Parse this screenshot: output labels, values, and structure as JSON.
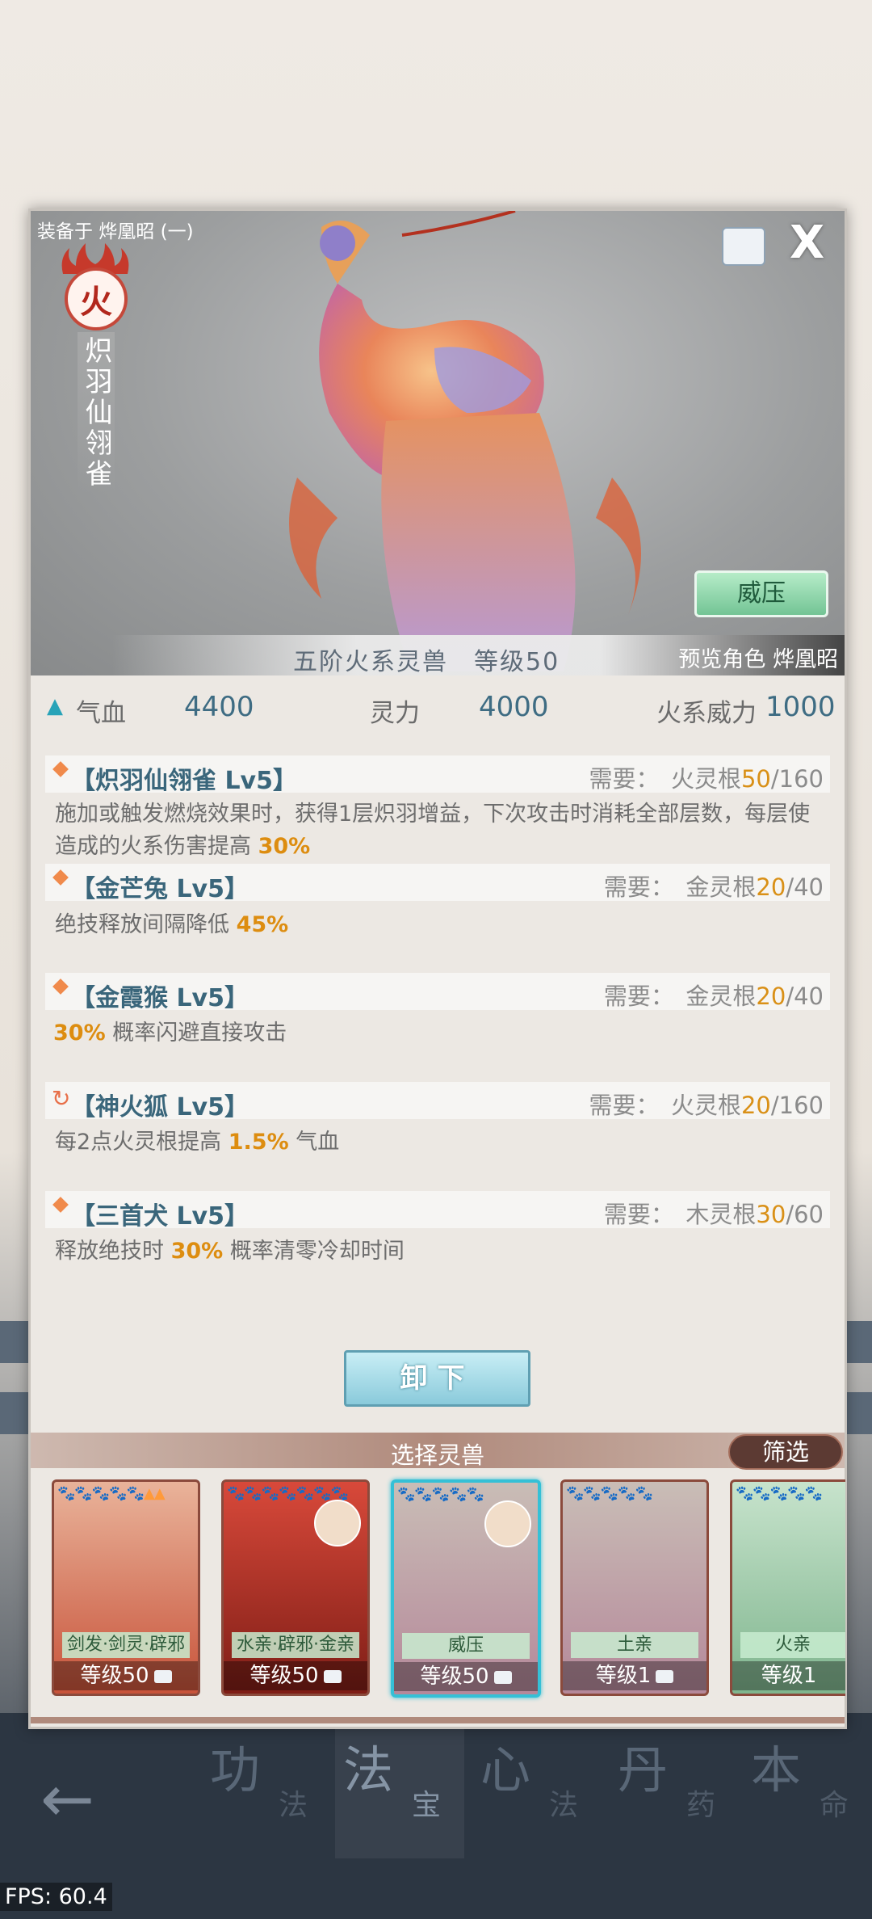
{
  "header": {
    "equipped_on": "装备于 烨凰昭 (一)",
    "element_badge": "火",
    "beast_name": "炽羽仙翎雀",
    "weiya_button": "威压",
    "grade_level": "五阶火系灵兽　等级50",
    "preview_role": "预览角色 烨凰昭"
  },
  "stats": {
    "hp_label": "气血",
    "hp_value": "4400",
    "spirit_label": "灵力",
    "spirit_value": "4000",
    "fire_label": "火系威力",
    "fire_value": "1000"
  },
  "skills": [
    {
      "name": "【炽羽仙翎雀 Lv5】",
      "req_prefix": "需要：　火灵根",
      "req_cur": "50",
      "req_max": "/160",
      "desc_a": "施加或触发燃烧效果时，获得1层炽羽增益，下次攻击时消耗全部层数，每层使造成的火系伤害提高 ",
      "desc_hl": "30%",
      "desc_b": ""
    },
    {
      "name": "【金芒兔 Lv5】",
      "req_prefix": "需要：　金灵根",
      "req_cur": "20",
      "req_max": "/40",
      "desc_a": "绝技释放间隔降低 ",
      "desc_hl": "45%",
      "desc_b": ""
    },
    {
      "name": "【金霞猴 Lv5】",
      "req_prefix": "需要：　金灵根",
      "req_cur": "20",
      "req_max": "/40",
      "desc_a": "",
      "desc_hl": "30%",
      "desc_b": " 概率闪避直接攻击"
    },
    {
      "name": "【神火狐 Lv5】",
      "req_prefix": "需要：　火灵根",
      "req_cur": "20",
      "req_max": "/160",
      "desc_a": "每2点火灵根提高 ",
      "desc_hl": "1.5%",
      "desc_b": " 气血"
    },
    {
      "name": "【三首犬 Lv5】",
      "req_prefix": "需要：　木灵根",
      "req_cur": "30",
      "req_max": "/60",
      "desc_a": "释放绝技时 ",
      "desc_hl": "30%",
      "desc_b": " 概率清零冷却时间"
    }
  ],
  "unload_button": "卸下",
  "selector": {
    "title": "选择灵兽",
    "filter": "筛选",
    "cards": [
      {
        "stars": "🐾🐾🐾🐾🐾▲▲",
        "tag": "剑发·剑灵·辟邪",
        "level": "等级50",
        "bg": "#d77a5c"
      },
      {
        "stars": "🐾🐾🐾🐾🐾🐾🐾",
        "tag": "水亲·辟邪·金亲",
        "level": "等级50",
        "bg": "#c2382b"
      },
      {
        "stars": "🐾🐾🐾🐾🐾",
        "tag": "威压",
        "level": "等级50",
        "bg": "#b8a9a2"
      },
      {
        "stars": "🐾🐾🐾🐾🐾",
        "tag": "土亲",
        "level": "等级1",
        "bg": "#b8a9a2"
      },
      {
        "stars": "🐾🐾🐾🐾🐾",
        "tag": "火亲",
        "level": "等级1",
        "bg": "#9fc7a8"
      }
    ]
  },
  "nav": {
    "tabs": [
      {
        "big": "功",
        "small": "法"
      },
      {
        "big": "法",
        "small": "宝"
      },
      {
        "big": "心",
        "small": "法"
      },
      {
        "big": "丹",
        "small": "药"
      },
      {
        "big": "本",
        "small": "命"
      }
    ]
  },
  "fps": "FPS: 60.4",
  "colors": {
    "accent_orange": "#dd8d10",
    "teal": "#35c0d6",
    "value_blue": "#3e6c83"
  }
}
